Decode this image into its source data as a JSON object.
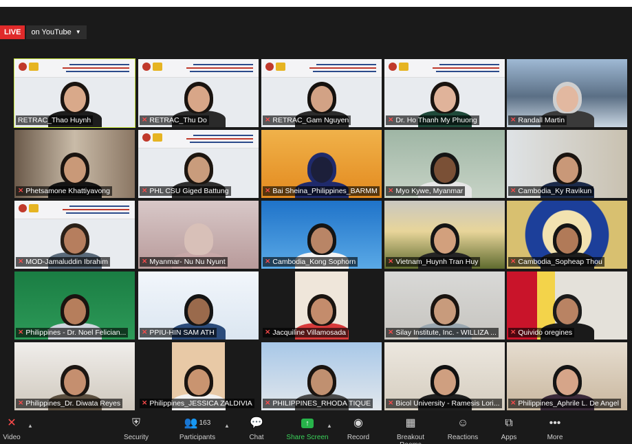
{
  "stream": {
    "live_label": "LIVE",
    "youtube_label": "on YouTube"
  },
  "colors": {
    "active_speaker_border": "#c8e63a",
    "live_red": "#e02a2a",
    "share_green": "#27b34a",
    "muted_mic": "#ff4b4b"
  },
  "participants": [
    {
      "name": "RETRAC_Thao Huynh",
      "muted": false,
      "active": true
    },
    {
      "name": "RETRAC_Thu Do",
      "muted": true
    },
    {
      "name": "RETRAC_Gam Nguyen",
      "muted": true
    },
    {
      "name": "Dr. Ho Thanh My Phuong",
      "muted": true
    },
    {
      "name": "Randall Martin",
      "muted": true
    },
    {
      "name": "Phetsamone Khattiyavong",
      "muted": true
    },
    {
      "name": "PHL CSU Giged Battung",
      "muted": true
    },
    {
      "name": "Bai Sheina_Philippines_BARMM",
      "muted": true
    },
    {
      "name": "Myo Kywe, Myanmar",
      "muted": true
    },
    {
      "name": "Cambodia_Ky Ravikun",
      "muted": true
    },
    {
      "name": "MOD-Jamaluddin Ibrahim",
      "muted": true
    },
    {
      "name": "Myanmar- Nu Nu Nyunt",
      "muted": true
    },
    {
      "name": "Cambodia_Kong Sophorn",
      "muted": true
    },
    {
      "name": "Vietnam_Huynh Tran Huy",
      "muted": true
    },
    {
      "name": "Cambodia_Sopheap Thou",
      "muted": true
    },
    {
      "name": "Philippines - Dr. Noel Felician...",
      "muted": true
    },
    {
      "name": "PPIU-HIN SAM ATH",
      "muted": true
    },
    {
      "name": "Jacquiline Villamosada",
      "muted": true
    },
    {
      "name": "Silay Institute, Inc. - WILLIZA ...",
      "muted": true
    },
    {
      "name": "Quivido oregines",
      "muted": true
    },
    {
      "name": "Philippines_Dr. Diwata Reyes",
      "muted": true
    },
    {
      "name": "Philippines_JESSICA ZALDIVIA",
      "muted": true
    },
    {
      "name": "PHILIPPINES_RHODA TIQUE",
      "muted": true
    },
    {
      "name": "Bicol University - Ramesis Lori...",
      "muted": true
    },
    {
      "name": "Philippines_Aphrile L. De Angel",
      "muted": true
    }
  ],
  "toolbar": {
    "video_label": "Video",
    "security_label": "Security",
    "participants_label": "Participants",
    "participants_count": "163",
    "chat_label": "Chat",
    "share_label": "Share Screen",
    "record_label": "Record",
    "breakout_label": "Breakout Rooms",
    "reactions_label": "Reactions",
    "apps_label": "Apps",
    "more_label": "More"
  }
}
